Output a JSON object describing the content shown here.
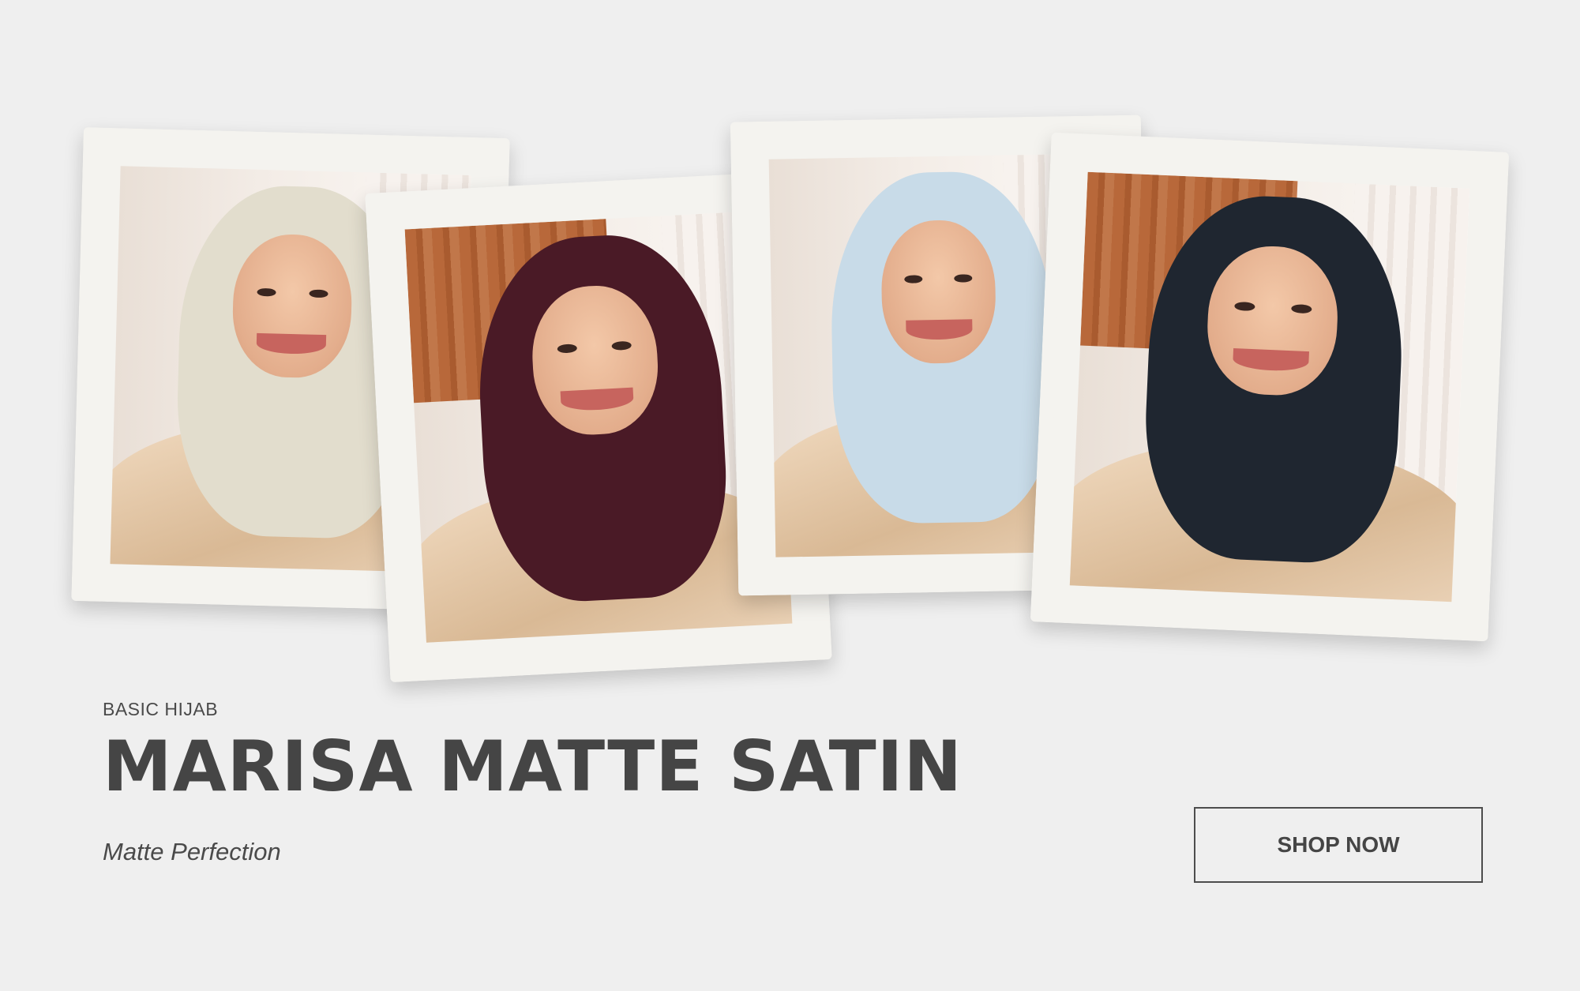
{
  "hero": {
    "kicker": "BASIC HIJAB",
    "title": "MARISA MATTE SATIN",
    "tagline": "Matte Perfection",
    "cta_label": "SHOP NOW"
  },
  "photos": [
    {
      "hijab_color": "#e2ddcd"
    },
    {
      "hijab_color": "#4a1a26"
    },
    {
      "hijab_color": "#c8dbe8"
    },
    {
      "hijab_color": "#1f2630"
    }
  ],
  "colors": {
    "background": "#efefef",
    "text": "#454545",
    "stamp_border": "#f4f3ef"
  }
}
